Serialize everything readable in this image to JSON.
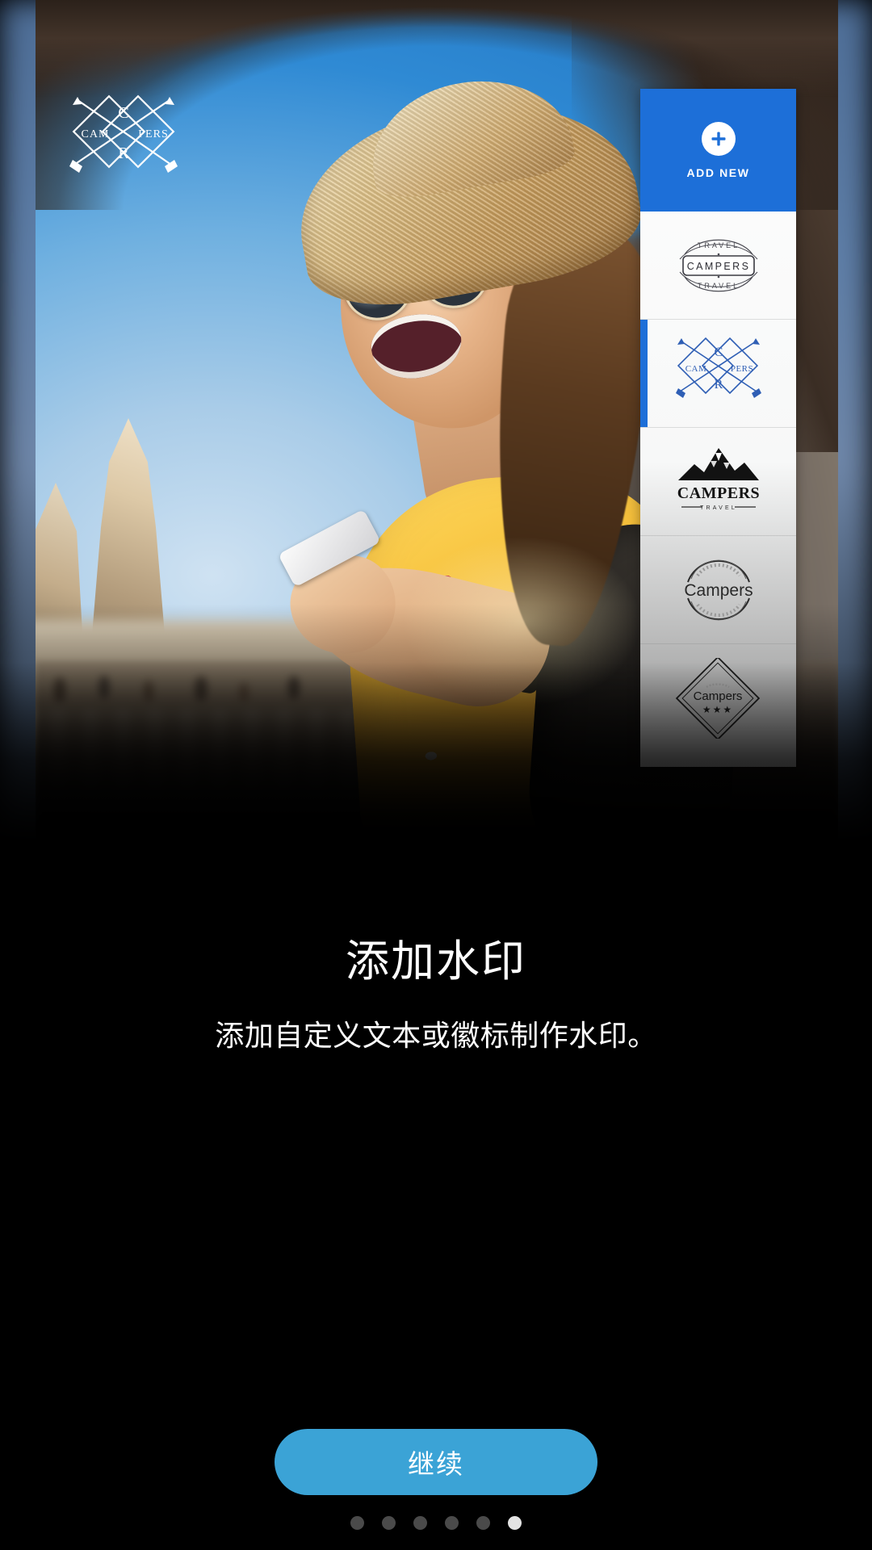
{
  "screen": {
    "title": "添加水印",
    "subtitle": "添加自定义文本或徽标制作水印。",
    "cta_label": "继续",
    "accent_color": "#3ba3d6",
    "panel_accent_color": "#1d6fd8",
    "background_color": "#000000"
  },
  "preview": {
    "description": "旅行照片预览：戴草帽和太阳镜的女子手持手机",
    "applied_watermark": {
      "name": "campers-diamond-arrows",
      "top_letter": "C",
      "left_word": "CAM",
      "right_word": "PERS",
      "bottom_letter": "R",
      "color": "#ffffff"
    }
  },
  "watermark_panel": {
    "add_new_label": "ADD NEW",
    "add_new_icon": "plus-icon",
    "items": [
      {
        "id": "campers-travel-badge",
        "label": "CAMPERS",
        "top_arc_text": "TRAVEL",
        "bottom_arc_text": "TRAVEL",
        "selected": false
      },
      {
        "id": "campers-diamond-arrows",
        "top_letter": "C",
        "left_word": "CAM",
        "right_word": "PERS",
        "bottom_letter": "R",
        "selected": true
      },
      {
        "id": "campers-mountain",
        "label": "CAMPERS",
        "sub_label": "TRAVEL",
        "selected": false
      },
      {
        "id": "campers-circle-stamp",
        "label": "Campers",
        "selected": false
      },
      {
        "id": "campers-diamond-stars",
        "label": "Campers",
        "stars": "★★★",
        "selected": false
      }
    ]
  },
  "pagination": {
    "total": 6,
    "active_index": 5
  }
}
